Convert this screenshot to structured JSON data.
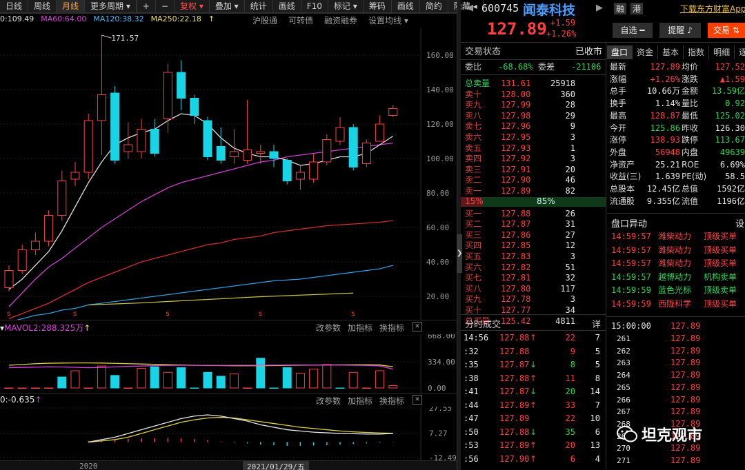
{
  "toolbar": {
    "items": [
      "日线",
      "周线",
      "月线",
      "更多周期 ▾"
    ],
    "active_index": 2,
    "plus": "+",
    "minus": "−",
    "adjust": "复权 ▾",
    "tools": [
      "叠加 ▾",
      "统计",
      "画线",
      "F10",
      "标记 ▾",
      "筹码",
      "画线",
      "简约",
      "隐藏 ◂"
    ]
  },
  "ma_legend": {
    "ma_partial": "0:109.49",
    "ma60": "MA60:64.00",
    "ma120": "MA120:38.32",
    "ma250": "MA250:22.18",
    "up_arrow": "↑"
  },
  "chart_links": [
    "沪股通",
    "可转债",
    "融资融券",
    "设置均线 ▾"
  ],
  "price_axis": [
    "160.00",
    "140.00",
    "120.00",
    "100.00",
    "80.00",
    "60.00",
    "40.00",
    "20.00"
  ],
  "peak_label": "171.57",
  "vol_header": {
    "label": "MAVOL2:288.325万",
    "prefix": "▾",
    "arrow": "↑"
  },
  "vol_axis": [
    "668.00",
    "334.00",
    "0.00"
  ],
  "macd_header": {
    "label": "0:-0.635",
    "arrow": "↑"
  },
  "macd_axis": [
    "27.55",
    "7.27",
    "-12.49"
  ],
  "panel_buttons": [
    "改参数",
    "加指标",
    "换指标"
  ],
  "close_glyph": "✕",
  "x_axis": {
    "year": "2020",
    "cursor_date": "2021/01/29/五"
  },
  "chart_data": {
    "type": "candlestick",
    "ylim": [
      12,
      176
    ],
    "candles": [
      {
        "o": 25,
        "c": 35,
        "h": 38,
        "l": 23
      },
      {
        "o": 35,
        "c": 47,
        "h": 50,
        "l": 33
      },
      {
        "o": 47,
        "c": 52,
        "h": 57,
        "l": 44
      },
      {
        "o": 52,
        "c": 67,
        "h": 70,
        "l": 49
      },
      {
        "o": 67,
        "c": 87,
        "h": 93,
        "l": 64
      },
      {
        "o": 88,
        "c": 92,
        "h": 98,
        "l": 84
      },
      {
        "o": 92,
        "c": 122,
        "h": 126,
        "l": 88
      },
      {
        "o": 122,
        "c": 137,
        "h": 171.57,
        "l": 102
      },
      {
        "o": 138,
        "c": 99,
        "h": 142,
        "l": 97
      },
      {
        "o": 104,
        "c": 108,
        "h": 121,
        "l": 100
      },
      {
        "o": 104,
        "c": 117,
        "h": 123,
        "l": 100
      },
      {
        "o": 117,
        "c": 103,
        "h": 123,
        "l": 101
      },
      {
        "o": 123,
        "c": 150,
        "h": 155,
        "l": 115
      },
      {
        "o": 150,
        "c": 135,
        "h": 157,
        "l": 128
      },
      {
        "o": 135,
        "c": 125,
        "h": 137,
        "l": 120
      },
      {
        "o": 122,
        "c": 101,
        "h": 124,
        "l": 99
      },
      {
        "o": 107,
        "c": 99,
        "h": 118,
        "l": 97
      },
      {
        "o": 101,
        "c": 104,
        "h": 117,
        "l": 97
      },
      {
        "o": 99,
        "c": 105,
        "h": 134,
        "l": 97
      },
      {
        "o": 103,
        "c": 104,
        "h": 108,
        "l": 97
      },
      {
        "o": 104,
        "c": 100,
        "h": 108,
        "l": 95
      },
      {
        "o": 99,
        "c": 87,
        "h": 100,
        "l": 85
      },
      {
        "o": 88,
        "c": 92,
        "h": 96,
        "l": 82
      },
      {
        "o": 88,
        "c": 98,
        "h": 103,
        "l": 86
      },
      {
        "o": 98,
        "c": 111,
        "h": 114,
        "l": 96
      },
      {
        "o": 110,
        "c": 118,
        "h": 124,
        "l": 108
      },
      {
        "o": 118,
        "c": 95,
        "h": 120,
        "l": 93
      },
      {
        "o": 97,
        "c": 109,
        "h": 111,
        "l": 95
      },
      {
        "o": 110,
        "c": 120,
        "h": 125,
        "l": 110
      },
      {
        "o": 125,
        "c": 129,
        "h": 131,
        "l": 124
      }
    ],
    "ma_short": [
      24,
      30,
      38,
      46,
      58,
      72,
      86,
      98,
      108,
      112,
      115,
      117,
      122,
      126,
      125,
      120,
      112,
      106,
      103,
      101,
      101,
      99,
      96,
      97,
      99,
      101,
      101,
      103,
      108,
      113
    ],
    "ma60": [
      14,
      22,
      30,
      37,
      42,
      48,
      54,
      60,
      65,
      70,
      75,
      79,
      83,
      86,
      88,
      90,
      92,
      94,
      96,
      98,
      99,
      101,
      102,
      103,
      104,
      105,
      106,
      107,
      108,
      109
    ],
    "ma120": [
      7,
      10,
      13,
      16,
      20,
      24,
      28,
      31,
      34,
      37,
      40,
      42,
      44,
      46,
      48,
      50,
      51,
      53,
      54,
      55,
      57,
      58,
      59,
      60,
      61,
      61.5,
      62,
      62.5,
      63,
      64
    ],
    "ma250": [
      5,
      7,
      9,
      10,
      12,
      13,
      15,
      16,
      17,
      18,
      19,
      20,
      21,
      22,
      23,
      24,
      25,
      26,
      27,
      28,
      29,
      29.5,
      30,
      31,
      32,
      33,
      34,
      35,
      36,
      38
    ],
    "ma_yellow": [
      15,
      15.3,
      15.6,
      15.9,
      16.2,
      16.6,
      17,
      17.4,
      17.8,
      18.2,
      18.6,
      19,
      19.4,
      19.8,
      20.1,
      20.4,
      20.7,
      21,
      21.3,
      21.6,
      21.9
    ],
    "volume": [
      0,
      0,
      0,
      0,
      140,
      220,
      0,
      280,
      160,
      0,
      250,
      270,
      200,
      260,
      0,
      200,
      150,
      180,
      0,
      380,
      0,
      260,
      190,
      240,
      300,
      0,
      200,
      0,
      220,
      30
    ],
    "volume_up": [
      true,
      true,
      true,
      true,
      false,
      true,
      true,
      true,
      false,
      true,
      true,
      false,
      true,
      false,
      false,
      false,
      false,
      true,
      true,
      false,
      false,
      false,
      true,
      true,
      true,
      false,
      true,
      true,
      true,
      true
    ],
    "vol_ma_white": [
      260,
      262,
      266,
      270,
      268,
      264,
      258,
      262,
      270,
      276,
      280,
      285,
      289,
      290,
      289,
      288,
      288,
      289,
      289,
      290,
      291,
      292,
      293,
      293,
      293,
      292,
      290,
      288,
      282,
      240
    ],
    "vol_ma_yellow": [
      290,
      300,
      310,
      316,
      318,
      320,
      320,
      318,
      314,
      310,
      306,
      302,
      298,
      294,
      290,
      288,
      286,
      284,
      284,
      285,
      286,
      288,
      290,
      292,
      294,
      295,
      296,
      296,
      294,
      270
    ],
    "macd_dif": [
      0,
      2,
      4,
      7,
      10,
      13,
      16,
      19,
      21,
      22,
      21,
      19,
      17,
      14,
      12,
      10,
      9,
      8,
      7.5,
      7,
      6.8,
      6.5,
      6.5,
      7
    ],
    "macd_dea": [
      0,
      1,
      2,
      4,
      7,
      10,
      13,
      16,
      18,
      19.5,
      20,
      19.5,
      18,
      16.5,
      15,
      13.5,
      12,
      11,
      10,
      9,
      8.3,
      7.8,
      7.4,
      7.2
    ],
    "macd_bar": [
      1,
      1.5,
      2,
      2.5,
      3,
      3,
      3.2,
      3,
      2.5,
      1.5,
      0.5,
      -0.5,
      -1,
      -2,
      -2.5,
      -3,
      -3,
      -2.8,
      -2.5,
      -2,
      -1.5,
      -1,
      -0.5,
      -0.2
    ]
  },
  "quote": {
    "code": "600745",
    "name": "闻泰科技",
    "price": "127.89",
    "change": "+1.59",
    "change_pct": "+1.26%",
    "badges": [
      "融",
      "港"
    ],
    "download_link": "下载东方财富App",
    "buttons": {
      "watch": "自选 ━",
      "alert": "提醒",
      "trade": "交易"
    }
  },
  "order_book": {
    "status_label": "交易状态",
    "status_value": "已收市",
    "weibi_label": "委比",
    "weibi_value": "-68.68%",
    "weicha_label": "委差",
    "weicha_value": "-21106",
    "total_sell_label": "总卖量",
    "total_sell_price": "131.61",
    "total_sell_vol": "25918",
    "asks": [
      {
        "label": "卖十",
        "price": "128.00",
        "vol": "360"
      },
      {
        "label": "卖九",
        "price": "127.99",
        "vol": "28"
      },
      {
        "label": "卖八",
        "price": "127.98",
        "vol": "29"
      },
      {
        "label": "卖七",
        "price": "127.96",
        "vol": "9"
      },
      {
        "label": "卖六",
        "price": "127.95",
        "vol": "3"
      },
      {
        "label": "卖五",
        "price": "127.93",
        "vol": "1"
      },
      {
        "label": "卖四",
        "price": "127.92",
        "vol": "3"
      },
      {
        "label": "卖三",
        "price": "127.91",
        "vol": "20"
      },
      {
        "label": "卖二",
        "price": "127.90",
        "vol": "46"
      },
      {
        "label": "卖一",
        "price": "127.89",
        "vol": "82"
      }
    ],
    "ratio_left": "15%",
    "ratio_right": "85%",
    "ratio_value": 0.15,
    "bids": [
      {
        "label": "买一",
        "price": "127.88",
        "vol": "26"
      },
      {
        "label": "买二",
        "price": "127.87",
        "vol": "31"
      },
      {
        "label": "买三",
        "price": "127.86",
        "vol": "27"
      },
      {
        "label": "买四",
        "price": "127.85",
        "vol": "12"
      },
      {
        "label": "买五",
        "price": "127.83",
        "vol": "3"
      },
      {
        "label": "买六",
        "price": "127.82",
        "vol": "51"
      },
      {
        "label": "买七",
        "price": "127.81",
        "vol": "32"
      },
      {
        "label": "买八",
        "price": "127.80",
        "vol": "117"
      },
      {
        "label": "买九",
        "price": "127.78",
        "vol": "3"
      },
      {
        "label": "买十",
        "price": "127.77",
        "vol": "34"
      }
    ],
    "total_buy_label": "总买量",
    "total_buy_price": "125.42",
    "total_buy_vol": "4811"
  },
  "ticks": {
    "title": "分时成交",
    "detail": "详",
    "rows": [
      {
        "t": "14:56",
        "p": "127.88",
        "dir": "up",
        "v": "22",
        "n": "7"
      },
      {
        "t": ":32",
        "p": "127.88",
        "dir": "none",
        "v": "9",
        "n": "5"
      },
      {
        "t": ":35",
        "p": "127.87",
        "dir": "down",
        "v": "8",
        "n": "5"
      },
      {
        "t": ":38",
        "p": "127.88",
        "dir": "up",
        "v": "11",
        "n": "8"
      },
      {
        "t": ":41",
        "p": "127.87",
        "dir": "down",
        "v": "20",
        "n": "14"
      },
      {
        "t": ":44",
        "p": "127.89",
        "dir": "up",
        "v": "33",
        "n": "7"
      },
      {
        "t": ":47",
        "p": "127.89",
        "dir": "none",
        "v": "22",
        "n": "10"
      },
      {
        "t": ":50",
        "p": "127.88",
        "dir": "down",
        "v": "35",
        "n": "6"
      },
      {
        "t": ":53",
        "p": "127.89",
        "dir": "up",
        "v": "20",
        "n": "13"
      },
      {
        "t": ":56",
        "p": "127.90",
        "dir": "up",
        "v": "6",
        "n": "4"
      }
    ]
  },
  "tabs": [
    "盘口",
    "资金",
    "基本",
    "指数",
    "明细",
    "逐笔"
  ],
  "stats": [
    {
      "l1": "最新",
      "v1": "127.89",
      "c1": "red",
      "l2": "均价",
      "v2": "127.52",
      "c2": "red"
    },
    {
      "l1": "涨幅",
      "v1": "+1.26%",
      "c1": "red",
      "l2": "涨跌",
      "v2": "▲1.59",
      "c2": "red"
    },
    {
      "l1": "总手",
      "v1": "10.66万",
      "c1": "white",
      "l2": "金额",
      "v2": "13.59亿",
      "c2": "green"
    },
    {
      "l1": "换手",
      "v1": "1.14%",
      "c1": "white",
      "l2": "量比",
      "v2": "0.92",
      "c2": "green"
    },
    {
      "l1": "最高",
      "v1": "128.87",
      "c1": "red",
      "l2": "最低",
      "v2": "125.02",
      "c2": "green"
    },
    {
      "l1": "今开",
      "v1": "125.86",
      "c1": "green",
      "l2": "昨收",
      "v2": "126.30",
      "c2": "white"
    },
    {
      "l1": "涨停",
      "v1": "138.93",
      "c1": "red",
      "l2": "跌停",
      "v2": "113.67",
      "c2": "green"
    },
    {
      "l1": "外盘",
      "v1": "56948",
      "c1": "red",
      "l2": "内盘",
      "v2": "49639",
      "c2": "green"
    },
    {
      "l1": "净资产",
      "v1": "25.21",
      "c1": "white",
      "l2": "ROE",
      "v2": "6.69%",
      "c2": "white"
    },
    {
      "l1": "收益(三)",
      "v1": "1.639",
      "c1": "white",
      "l2": "PE(动)",
      "v2": "58.5",
      "c2": "white"
    },
    {
      "l1": "总股本",
      "v1": "12.45亿",
      "c1": "white",
      "l2": "总值",
      "v2": "1592亿",
      "c2": "white"
    },
    {
      "l1": "流通股",
      "v1": "9.355亿",
      "c1": "white",
      "l2": "流值",
      "v2": "1196亿",
      "c2": "white"
    }
  ],
  "alerts": {
    "title": "盘口异动",
    "settings": "设",
    "rows": [
      {
        "t": "14:59:57",
        "name": "潍柴动力",
        "type": "顶级买单",
        "c": "red"
      },
      {
        "t": "14:59:57",
        "name": "潍柴动力",
        "type": "顶级买单",
        "c": "red"
      },
      {
        "t": "14:59:57",
        "name": "潍柴动力",
        "type": "顶级买单",
        "c": "red"
      },
      {
        "t": "14:59:57",
        "name": "越博动力",
        "type": "机构卖单",
        "c": "green"
      },
      {
        "t": "14:59:59",
        "name": "蓝色光标",
        "type": "顶级卖单",
        "c": "green"
      },
      {
        "t": "14:59:59",
        "name": "西陇科学",
        "type": "顶级买单",
        "c": "red"
      }
    ]
  },
  "tick_list": {
    "header_time": "15:00:00",
    "header_price": "127.89",
    "rows": [
      {
        "i": "261",
        "p": "127.89"
      },
      {
        "i": "262",
        "p": "127.89"
      },
      {
        "i": "263",
        "p": "127.89"
      },
      {
        "i": "264",
        "p": "127.89"
      },
      {
        "i": "265",
        "p": "127.89"
      },
      {
        "i": "266",
        "p": "127.89"
      },
      {
        "i": "267",
        "p": "127.89"
      },
      {
        "i": "268",
        "p": "127.89"
      },
      {
        "i": "269",
        "p": "127.89"
      },
      {
        "i": "270",
        "p": "127.89"
      },
      {
        "i": "271",
        "p": "127.89"
      }
    ]
  },
  "watermark": "坦克观市",
  "collapse_arrow": "❯",
  "nav": {
    "prev": "◀",
    "next": "▶"
  },
  "colors": {
    "up": "#ff4040",
    "down": "#18d4e4",
    "bg": "#000000",
    "accent": "#ff9c3a"
  }
}
